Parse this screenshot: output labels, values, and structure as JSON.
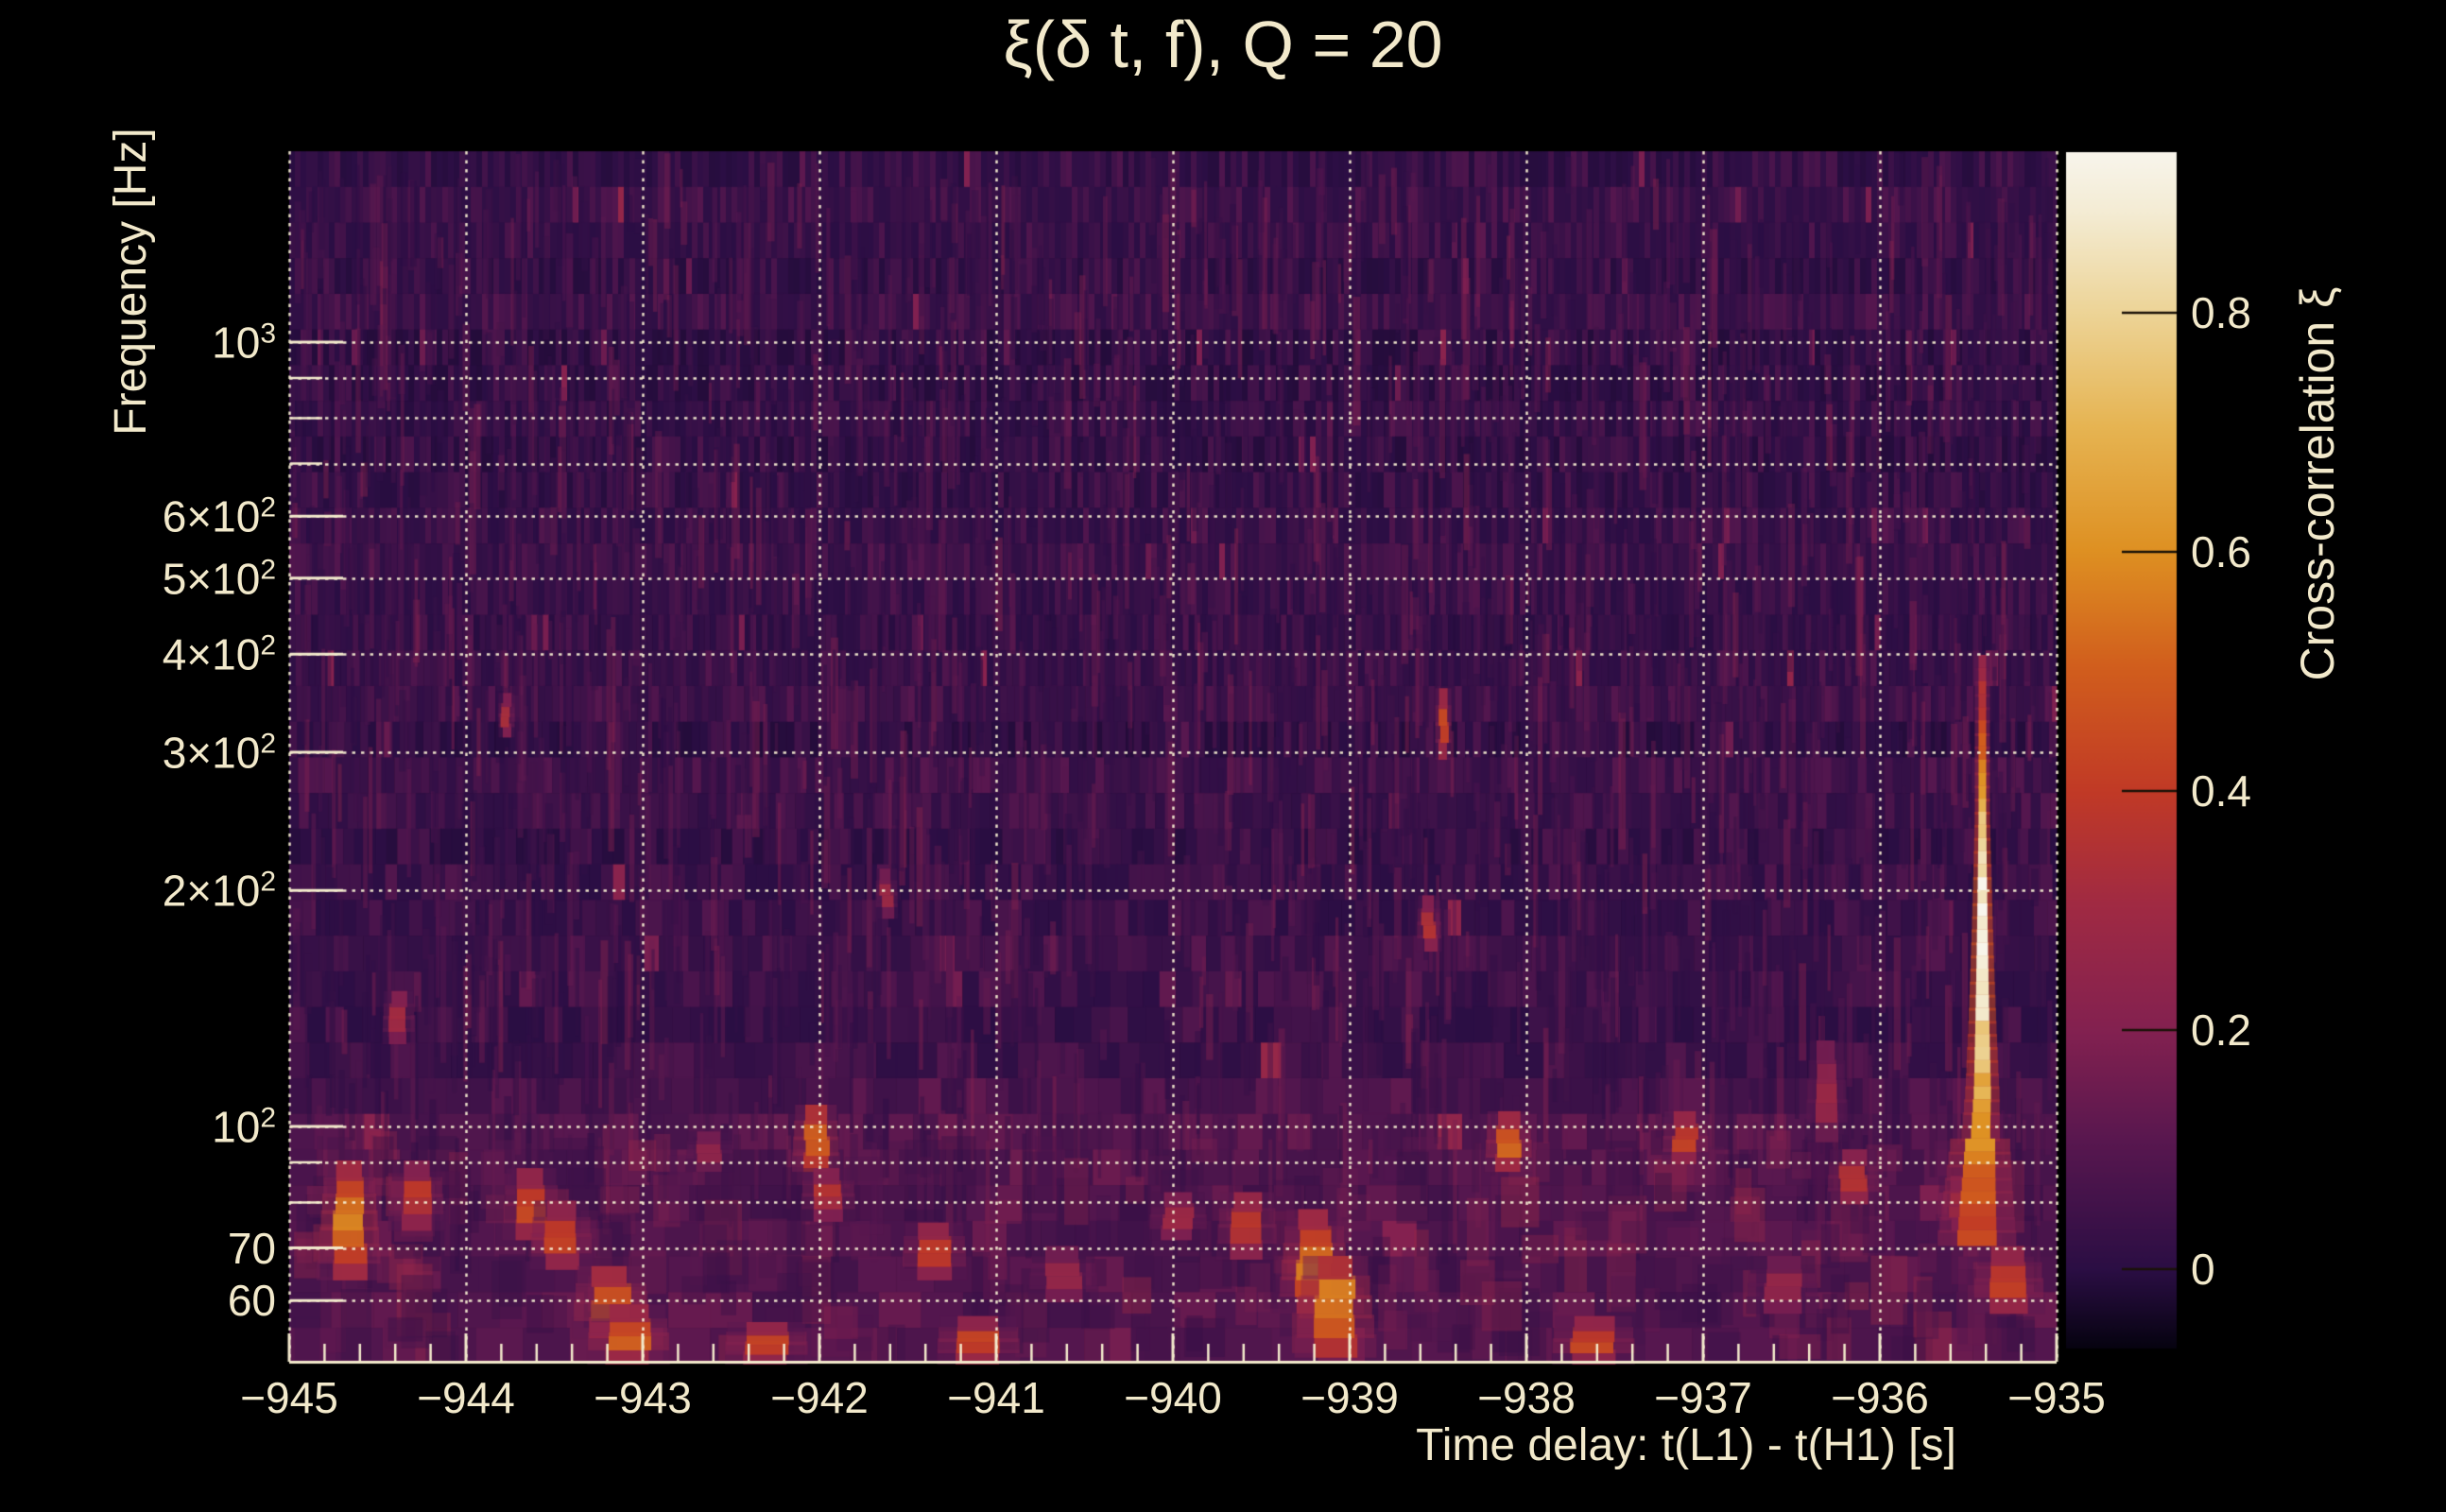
{
  "title": "ξ(δ t, f), Q = 20",
  "axes": {
    "x": {
      "title": "Time delay: t(L1) - t(H1) [s]",
      "range_s": [
        -945,
        -935
      ],
      "major_tick_labels": [
        "−945",
        "−944",
        "−943",
        "−942",
        "−941",
        "−940",
        "−939",
        "−938",
        "−937",
        "−936",
        "−935"
      ],
      "major_tick_values": [
        -945,
        -944,
        -943,
        -942,
        -941,
        -940,
        -939,
        -938,
        -937,
        -936,
        -935
      ],
      "minor_tick_step_s": 0.2
    },
    "y": {
      "title": "Frequency [Hz]",
      "scale": "log",
      "range_hz": [
        50.2,
        1751
      ],
      "tick_labels": [
        {
          "base": "10",
          "exp": "3",
          "f": 1000
        },
        {
          "base": "6×10",
          "exp": "2",
          "f": 600
        },
        {
          "base": "5×10",
          "exp": "2",
          "f": 500
        },
        {
          "base": "4×10",
          "exp": "2",
          "f": 400
        },
        {
          "base": "3×10",
          "exp": "2",
          "f": 300
        },
        {
          "base": "2×10",
          "exp": "2",
          "f": 200
        },
        {
          "base": "10",
          "exp": "2",
          "f": 100
        },
        {
          "base": "70",
          "exp": "",
          "f": 70
        },
        {
          "base": "60",
          "exp": "",
          "f": 60
        }
      ],
      "minor_tick_hz": [
        900,
        800,
        700,
        90,
        80
      ],
      "gridlines_hz": [
        60,
        70,
        80,
        90,
        100,
        200,
        300,
        400,
        500,
        600,
        700,
        800,
        900,
        1000
      ]
    },
    "colorbar": {
      "title": "Cross-correlation ξ",
      "tick_labels": [
        {
          "label": "0.8",
          "v": 0.8
        },
        {
          "label": "0.6",
          "v": 0.6
        },
        {
          "label": "0.4",
          "v": 0.4
        },
        {
          "label": "0.2",
          "v": 0.2
        },
        {
          "label": "0",
          "v": 0
        }
      ],
      "value_range": [
        -0.066,
        0.935
      ]
    }
  },
  "colors": {
    "background": "#000000",
    "text": "#f2e9cb",
    "gridline": "#f4ecd0",
    "axis_line": "#f3eacc",
    "colorbar_tick": "#1a1208"
  },
  "chart_data": {
    "type": "heatmap",
    "title": "ξ(δ t, f), Q = 20",
    "xlabel": "Time delay: t(L1) - t(H1) [s]",
    "ylabel": "Frequency [Hz]",
    "x_range_s": [
      -945,
      -935
    ],
    "y_range_hz": [
      50.2,
      1751
    ],
    "y_scale": "log",
    "colorbar": {
      "label": "Cross-correlation ξ",
      "tick_values": [
        0,
        0.2,
        0.4,
        0.6,
        0.8
      ],
      "value_range": [
        -0.066,
        0.935
      ],
      "colormap": "inferno-like (black → purple → magenta → red → orange → gold → cream)"
    },
    "grid": "dotted cream gridlines at integer seconds and log-decade frequencies",
    "background_noise": {
      "description": "dark purple Q-transform tile noise with vertical striations; tiles widen toward low frequency; slightly elevated below ~110 Hz",
      "mean_norm_level": 0.09,
      "seed": 1337
    },
    "colormap_stops": [
      {
        "pos": 0.0,
        "color": "#060310"
      },
      {
        "pos": 0.066,
        "color": "#2b0e44"
      },
      {
        "pos": 0.17,
        "color": "#57174f"
      },
      {
        "pos": 0.266,
        "color": "#832150"
      },
      {
        "pos": 0.37,
        "color": "#a02a43"
      },
      {
        "pos": 0.466,
        "color": "#c13a26"
      },
      {
        "pos": 0.57,
        "color": "#d15e1d"
      },
      {
        "pos": 0.666,
        "color": "#de9022"
      },
      {
        "pos": 0.77,
        "color": "#e6b452"
      },
      {
        "pos": 0.866,
        "color": "#edd497"
      },
      {
        "pos": 0.95,
        "color": "#f4ecd4"
      },
      {
        "pos": 1.0,
        "color": "#f8f5ec"
      }
    ],
    "features": [
      {
        "t_s": -944.66,
        "f_lo_hz": 64,
        "f_hi_hz": 90,
        "peak": 0.62
      },
      {
        "t_s": -944.38,
        "f_lo_hz": 128,
        "f_hi_hz": 148,
        "peak": 0.38
      },
      {
        "t_s": -944.28,
        "f_lo_hz": 74,
        "f_hi_hz": 90,
        "peak": 0.45
      },
      {
        "t_s": -943.77,
        "f_lo_hz": 315,
        "f_hi_hz": 355,
        "peak": 0.42
      },
      {
        "t_s": -943.63,
        "f_lo_hz": 72,
        "f_hi_hz": 88,
        "peak": 0.52
      },
      {
        "t_s": -943.46,
        "f_lo_hz": 66,
        "f_hi_hz": 80,
        "peak": 0.5
      },
      {
        "t_s": -943.18,
        "f_lo_hz": 54,
        "f_hi_hz": 66,
        "peak": 0.56
      },
      {
        "t_s": -943.08,
        "f_lo_hz": 50,
        "f_hi_hz": 59,
        "peak": 0.56
      },
      {
        "t_s": -942.62,
        "f_lo_hz": 88,
        "f_hi_hz": 98,
        "peak": 0.35
      },
      {
        "t_s": -942.3,
        "f_lo_hz": 50,
        "f_hi_hz": 56,
        "peak": 0.52
      },
      {
        "t_s": -942.02,
        "f_lo_hz": 88,
        "f_hi_hz": 106,
        "peak": 0.62
      },
      {
        "t_s": -941.95,
        "f_lo_hz": 76,
        "f_hi_hz": 88,
        "peak": 0.42
      },
      {
        "t_s": -941.62,
        "f_lo_hz": 185,
        "f_hi_hz": 212,
        "peak": 0.35
      },
      {
        "t_s": -941.35,
        "f_lo_hz": 64,
        "f_hi_hz": 75,
        "peak": 0.45
      },
      {
        "t_s": -941.1,
        "f_lo_hz": 50,
        "f_hi_hz": 57,
        "peak": 0.5
      },
      {
        "t_s": -940.62,
        "f_lo_hz": 60,
        "f_hi_hz": 70,
        "peak": 0.35
      },
      {
        "t_s": -939.97,
        "f_lo_hz": 72,
        "f_hi_hz": 82,
        "peak": 0.38
      },
      {
        "t_s": -939.58,
        "f_lo_hz": 68,
        "f_hi_hz": 82,
        "peak": 0.48
      },
      {
        "t_s": -939.2,
        "f_lo_hz": 58,
        "f_hi_hz": 78,
        "peak": 0.6
      },
      {
        "t_s": -939.08,
        "f_lo_hz": 51,
        "f_hi_hz": 68,
        "peak": 0.66
      },
      {
        "t_s": -938.55,
        "f_lo_hz": 168,
        "f_hi_hz": 196,
        "peak": 0.42
      },
      {
        "t_s": -938.47,
        "f_lo_hz": 295,
        "f_hi_hz": 360,
        "peak": 0.52
      },
      {
        "t_s": -938.1,
        "f_lo_hz": 88,
        "f_hi_hz": 104,
        "peak": 0.6
      },
      {
        "t_s": -937.62,
        "f_lo_hz": 50,
        "f_hi_hz": 57,
        "peak": 0.5
      },
      {
        "t_s": -937.1,
        "f_lo_hz": 90,
        "f_hi_hz": 104,
        "peak": 0.48
      },
      {
        "t_s": -936.55,
        "f_lo_hz": 58,
        "f_hi_hz": 68,
        "peak": 0.35
      },
      {
        "t_s": -936.3,
        "f_lo_hz": 96,
        "f_hi_hz": 128,
        "peak": 0.35
      },
      {
        "t_s": -936.15,
        "f_lo_hz": 80,
        "f_hi_hz": 93,
        "peak": 0.45
      },
      {
        "t_s": -935.52,
        "f_lo_hz": 74,
        "f_hi_hz": 86,
        "peak": 0.42
      },
      {
        "t_s": -935.27,
        "f_lo_hz": 58,
        "f_hi_hz": 70,
        "peak": 0.5
      }
    ],
    "chirp": {
      "t_s": -935.42,
      "f_lo_hz": 70,
      "f_hi_hz": 390,
      "peak": 1.0,
      "profile": [
        [
          390,
          0.33
        ],
        [
          320,
          0.5
        ],
        [
          260,
          0.72
        ],
        [
          210,
          0.95
        ],
        [
          175,
          1.0
        ],
        [
          145,
          0.95
        ],
        [
          120,
          0.8
        ],
        [
          100,
          0.68
        ],
        [
          85,
          0.56
        ],
        [
          72,
          0.48
        ]
      ],
      "description": "bright narrow vertical chirp streak near t = −935.4 s, brightest (near white) around 150–200 Hz, widening orange base near 70–90 Hz"
    }
  }
}
